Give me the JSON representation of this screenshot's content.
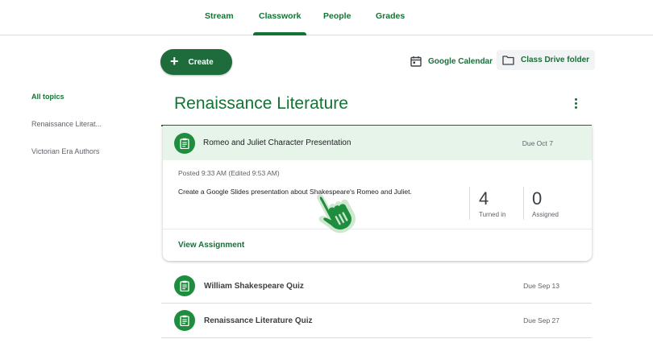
{
  "nav": {
    "tabs": [
      {
        "label": "Stream"
      },
      {
        "label": "Classwork"
      },
      {
        "label": "People"
      },
      {
        "label": "Grades"
      }
    ],
    "active_tab": "Classwork"
  },
  "sidebar": {
    "items": [
      {
        "label": "All topics"
      },
      {
        "label": "Renaissance Literat..."
      },
      {
        "label": "Victorian Era Authors"
      }
    ]
  },
  "toolbar": {
    "create_label": "Create",
    "calendar_label": "Google Calendar",
    "drive_label": "Class Drive folder"
  },
  "topic": {
    "title": "Renaissance Literature",
    "expanded": {
      "title": "Romeo  and Juliet Character Presentation",
      "due": "Due Oct 7",
      "posted": "Posted 9:33 AM (Edited 9:53 AM)",
      "description": "Create a Google Slides presentation about Shakespeare's Romeo and Juliet.",
      "turned_in_value": "4",
      "turned_in_label": "Turned in",
      "assigned_value": "0",
      "assigned_label": "Assigned",
      "view_label": "View Assignment"
    },
    "items": [
      {
        "title": "William Shakespeare Quiz",
        "due": "Due Sep 13"
      },
      {
        "title": "Renaissance Literature Quiz",
        "due": "Due Sep 27"
      }
    ]
  },
  "colors": {
    "accent": "#137333",
    "button": "#1e6b3c",
    "icon_bg": "#1e8e3e",
    "highlight": "#e6f4ea"
  }
}
